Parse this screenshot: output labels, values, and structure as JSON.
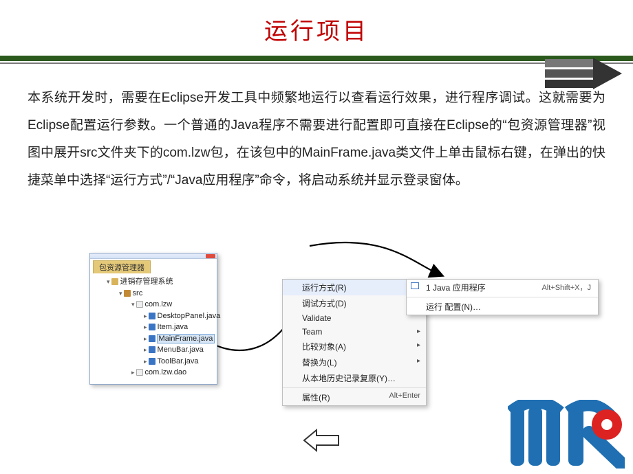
{
  "title": "运行项目",
  "paragraph": "本系统开发时，需要在Eclipse开发工具中频繁地运行以查看运行效果，进行程序调试。这就需要为Eclipse配置运行参数。一个普通的Java程序不需要进行配置即可直接在Eclipse的“包资源管理器”视图中展开src文件夹下的com.lzw包，在该包中的MainFrame.java类文件上单击鼠标右键，在弹出的快捷菜单中选择“运行方式”/“Java应用程序”命令，将启动系统并显示登录窗体。",
  "packageExplorer": {
    "tabLabel": "包资源管理器",
    "project": "进销存管理系统",
    "srcFolder": "src",
    "pkg1": "com.lzw",
    "files": {
      "f0": "DesktopPanel.java",
      "f1": "Item.java",
      "f2": "MainFrame.java",
      "f3": "MenuBar.java",
      "f4": "ToolBar.java"
    },
    "pkg2": "com.lzw.dao"
  },
  "contextMenu": {
    "runAs": "运行方式(R)",
    "debugAs": "调试方式(D)",
    "validate": "Validate",
    "team": "Team",
    "compareWith": "比较对象(A)",
    "replaceWith": "替换为(L)",
    "restoreLocal": "从本地历史记录复原(Y)…",
    "properties": "属性(R)",
    "propertiesKey": "Alt+Enter"
  },
  "submenu": {
    "javaApp": "1 Java 应用程序",
    "javaAppKey": "Alt+Shift+X，J",
    "runConfig": "运行 配置(N)…"
  }
}
